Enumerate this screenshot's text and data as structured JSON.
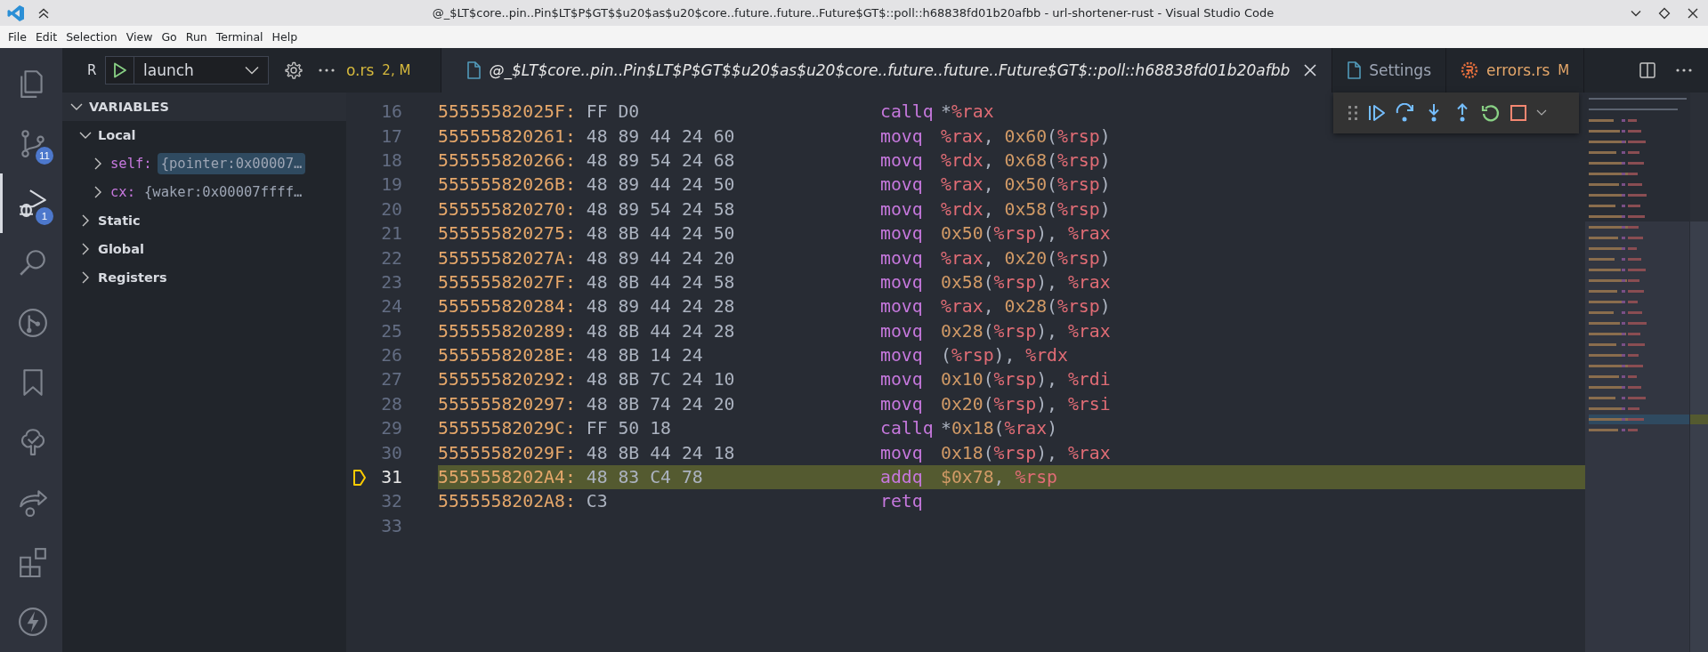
{
  "window": {
    "title": "@_$LT$core..pin..Pin$LT$P$GT$$u20$as$u20$core..future..future..Future$GT$::poll::h68838fd01b20afbb - url-shortener-rust - Visual Studio Code"
  },
  "menu": [
    "File",
    "Edit",
    "Selection",
    "View",
    "Go",
    "Run",
    "Terminal",
    "Help"
  ],
  "activity_bar": {
    "items": [
      {
        "selected": false
      },
      {
        "selected": false,
        "badge": "11"
      },
      {
        "selected": true,
        "badge": "1"
      },
      {
        "selected": false
      },
      {
        "selected": false
      },
      {
        "selected": false
      },
      {
        "selected": false
      },
      {
        "selected": false
      },
      {
        "selected": false
      },
      {
        "selected": false
      }
    ]
  },
  "sidebar": {
    "title": "R",
    "launch_config": "launch",
    "section": {
      "title": "VARIABLES",
      "expanded": true,
      "scopes": [
        {
          "label": "Local",
          "expanded": true,
          "children": [
            {
              "name": "self:",
              "value": "{pointer:0x00007…",
              "selected": true,
              "expanded": false
            },
            {
              "name": "cx:",
              "value": "{waker:0x00007ffff…",
              "selected": false,
              "expanded": false
            }
          ]
        },
        {
          "label": "Static",
          "expanded": false
        },
        {
          "label": "Global",
          "expanded": false
        },
        {
          "label": "Registers",
          "expanded": false
        }
      ]
    }
  },
  "tabs": [
    {
      "kind": "cut",
      "label": "o.rs",
      "status": "2, M",
      "color": "#d7ba3d",
      "selected": false,
      "preview": false
    },
    {
      "kind": "file",
      "label": "@_$LT$core..pin..Pin$LT$P$GT$$u20$as$u20$core..future..future..Future$GT$::poll::h68838fd01b20afbb",
      "color": "#e6e6e6",
      "selected": true,
      "preview": true
    },
    {
      "kind": "file",
      "label": "Settings",
      "color": "#9da5b4",
      "selected": false,
      "preview": false
    },
    {
      "kind": "rust",
      "label": "errors.rs",
      "status": "M",
      "color": "#e5a76a",
      "selected": false,
      "preview": false
    }
  ],
  "editor": {
    "lines": [
      {
        "line": "16",
        "address": "55555582025F:",
        "bytes": "FF D0",
        "mnemonic": "callq",
        "operands": "*%rax",
        "current": false
      },
      {
        "line": "17",
        "address": "555555820261:",
        "bytes": "48 89 44 24 60",
        "mnemonic": "movq",
        "operands": "%rax, 0x60(%rsp)",
        "current": false
      },
      {
        "line": "18",
        "address": "555555820266:",
        "bytes": "48 89 54 24 68",
        "mnemonic": "movq",
        "operands": "%rdx, 0x68(%rsp)",
        "current": false
      },
      {
        "line": "19",
        "address": "55555582026B:",
        "bytes": "48 89 44 24 50",
        "mnemonic": "movq",
        "operands": "%rax, 0x50(%rsp)",
        "current": false
      },
      {
        "line": "20",
        "address": "555555820270:",
        "bytes": "48 89 54 24 58",
        "mnemonic": "movq",
        "operands": "%rdx, 0x58(%rsp)",
        "current": false
      },
      {
        "line": "21",
        "address": "555555820275:",
        "bytes": "48 8B 44 24 50",
        "mnemonic": "movq",
        "operands": "0x50(%rsp), %rax",
        "current": false
      },
      {
        "line": "22",
        "address": "55555582027A:",
        "bytes": "48 89 44 24 20",
        "mnemonic": "movq",
        "operands": "%rax, 0x20(%rsp)",
        "current": false
      },
      {
        "line": "23",
        "address": "55555582027F:",
        "bytes": "48 8B 44 24 58",
        "mnemonic": "movq",
        "operands": "0x58(%rsp), %rax",
        "current": false
      },
      {
        "line": "24",
        "address": "555555820284:",
        "bytes": "48 89 44 24 28",
        "mnemonic": "movq",
        "operands": "%rax, 0x28(%rsp)",
        "current": false
      },
      {
        "line": "25",
        "address": "555555820289:",
        "bytes": "48 8B 44 24 28",
        "mnemonic": "movq",
        "operands": "0x28(%rsp), %rax",
        "current": false
      },
      {
        "line": "26",
        "address": "55555582028E:",
        "bytes": "48 8B 14 24",
        "mnemonic": "movq",
        "operands": "(%rsp), %rdx",
        "current": false
      },
      {
        "line": "27",
        "address": "555555820292:",
        "bytes": "48 8B 7C 24 10",
        "mnemonic": "movq",
        "operands": "0x10(%rsp), %rdi",
        "current": false
      },
      {
        "line": "28",
        "address": "555555820297:",
        "bytes": "48 8B 74 24 20",
        "mnemonic": "movq",
        "operands": "0x20(%rsp), %rsi",
        "current": false
      },
      {
        "line": "29",
        "address": "55555582029C:",
        "bytes": "FF 50 18",
        "mnemonic": "callq",
        "operands": "*0x18(%rax)",
        "current": false
      },
      {
        "line": "30",
        "address": "55555582029F:",
        "bytes": "48 8B 44 24 18",
        "mnemonic": "movq",
        "operands": "0x18(%rsp), %rax",
        "current": false
      },
      {
        "line": "31",
        "address": "5555558202A4:",
        "bytes": "48 83 C4 78",
        "mnemonic": "addq",
        "operands": "$0x78, %rsp",
        "current": true
      },
      {
        "line": "32",
        "address": "5555558202A8:",
        "bytes": "C3",
        "mnemonic": "retq",
        "current": false
      },
      {
        "line": "33",
        "current": false
      }
    ]
  }
}
